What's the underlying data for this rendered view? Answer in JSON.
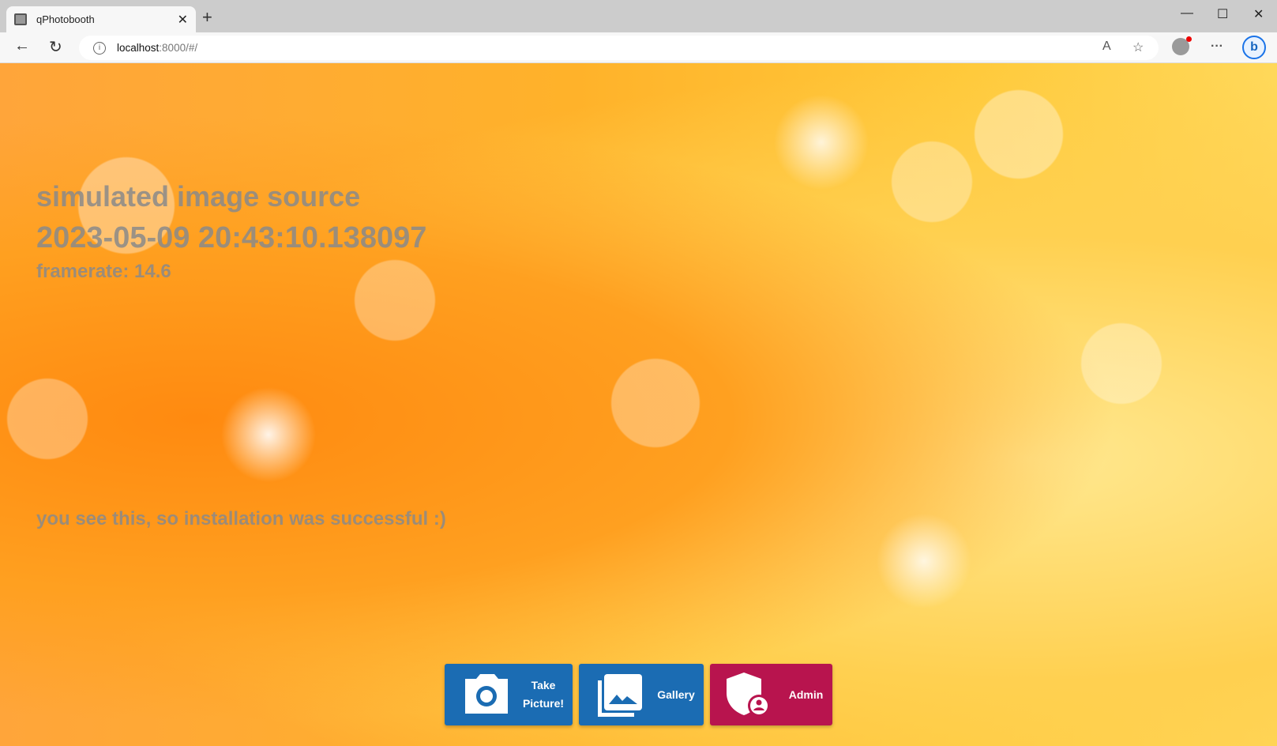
{
  "browser": {
    "tab_title": "qPhotobooth",
    "url_host": "localhost",
    "url_rest": ":8000/#/"
  },
  "page": {
    "source_label": "simulated image source",
    "timestamp": "2023-05-09 20:43:10.138097",
    "framerate": "framerate: 14.6",
    "success_message": "you see this, so installation was successful :)"
  },
  "buttons": {
    "take_picture_1": "Take",
    "take_picture_2": "Picture!",
    "gallery": "Gallery",
    "admin": "Admin"
  },
  "colors": {
    "primary": "#1b6cb3",
    "admin": "#b8144e"
  }
}
